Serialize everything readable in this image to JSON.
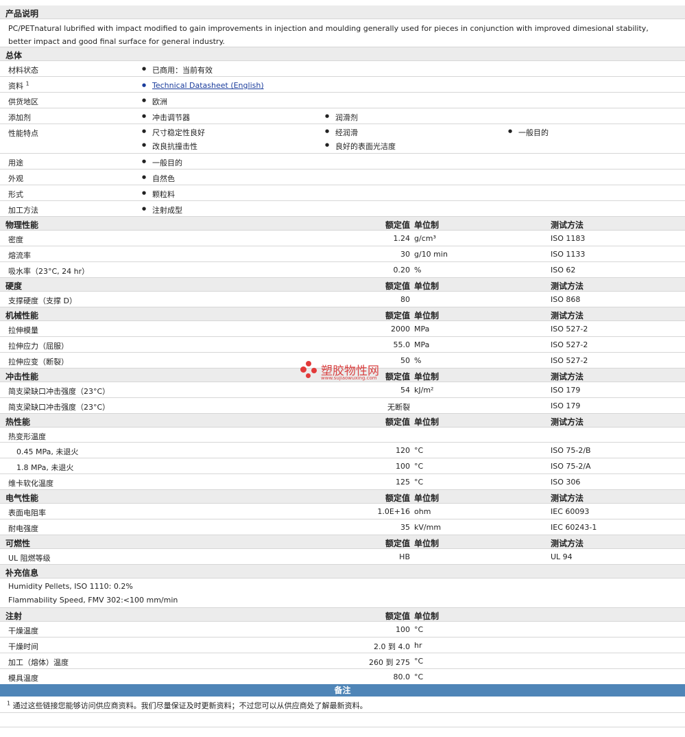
{
  "desc": {
    "header": "产品说明",
    "text": "PC/PETnatural lubrified with impact modified to gain improvements in injection and moulding generally used for pieces in conjunction with improved dimesional stability, better impact and good final surface for general industry."
  },
  "general": {
    "header": "总体",
    "status_label": "材料状态",
    "status_value": "已商用：当前有效",
    "resource_label": "资料",
    "resource_sup": "1",
    "resource_link": "Technical Datasheet (English)",
    "region_label": "供货地区",
    "region_value": "欧洲",
    "additive_label": "添加剂",
    "additive_1": "冲击调节器",
    "additive_2": "润滑剂",
    "feature_label": "性能特点",
    "feature_1": "尺寸稳定性良好",
    "feature_2": "经润滑",
    "feature_3": "一般目的",
    "feature_4": "改良抗撞击性",
    "feature_5": "良好的表面光洁度",
    "use_label": "用途",
    "use_value": "一般目的",
    "look_label": "外观",
    "look_value": "自然色",
    "form_label": "形式",
    "form_value": "颗粒料",
    "proc_label": "加工方法",
    "proc_value": "注射成型"
  },
  "col_value": "额定值",
  "col_unit": "单位制",
  "col_method": "测试方法",
  "physical": {
    "header": "物理性能",
    "rows": [
      {
        "label": "密度",
        "value": "1.24",
        "unit": "g/cm³",
        "method": "ISO 1183"
      },
      {
        "label": "熔流率",
        "value": "30",
        "unit": "g/10 min",
        "method": "ISO 1133"
      },
      {
        "label": "吸水率（23°C, 24 hr）",
        "value": "0.20",
        "unit": "%",
        "method": "ISO 62"
      }
    ]
  },
  "hardness": {
    "header": "硬度",
    "rows": [
      {
        "label": "支撑硬度（支撑 D）",
        "value": "80",
        "unit": "",
        "method": "ISO 868"
      }
    ]
  },
  "mechanical": {
    "header": "机械性能",
    "rows": [
      {
        "label": "拉伸模量",
        "value": "2000",
        "unit": "MPa",
        "method": "ISO 527-2"
      },
      {
        "label": "拉伸应力（屈服）",
        "value": "55.0",
        "unit": "MPa",
        "method": "ISO 527-2"
      },
      {
        "label": "拉伸应变（断裂）",
        "value": "50",
        "unit": "%",
        "method": "ISO 527-2"
      }
    ]
  },
  "impact": {
    "header": "冲击性能",
    "rows": [
      {
        "label": "简支梁缺口冲击强度（23°C）",
        "value": "54",
        "unit": "kJ/m²",
        "method": "ISO 179"
      },
      {
        "label": "简支梁缺口冲击强度（23°C）",
        "value": "无断裂",
        "unit": "",
        "method": "ISO 179"
      }
    ]
  },
  "thermal": {
    "header": "热性能",
    "hdt_label": "热变形温度",
    "rows": [
      {
        "label": "0.45 MPa, 未退火",
        "value": "120",
        "unit": "°C",
        "method": "ISO 75-2/B"
      },
      {
        "label": "1.8 MPa, 未退火",
        "value": "100",
        "unit": "°C",
        "method": "ISO 75-2/A"
      },
      {
        "label": "维卡软化温度",
        "value": "125",
        "unit": "°C",
        "method": "ISO 306"
      }
    ]
  },
  "electrical": {
    "header": "电气性能",
    "rows": [
      {
        "label": "表面电阻率",
        "value": "1.0E+16",
        "unit": "ohm",
        "method": "IEC 60093"
      },
      {
        "label": "耐电强度",
        "value": "35",
        "unit": "kV/mm",
        "method": "IEC 60243-1"
      }
    ]
  },
  "flammability": {
    "header": "可燃性",
    "rows": [
      {
        "label": "UL 阻燃等级",
        "value": "HB",
        "unit": "",
        "method": "UL 94"
      }
    ]
  },
  "supplement": {
    "header": "补充信息",
    "line1": "Humidity Pellets, ISO 1110: 0.2%",
    "line2": "Flammability Speed, FMV 302:<100 mm/min"
  },
  "injection": {
    "header": "注射",
    "rows": [
      {
        "label": "干燥温度",
        "value": "100",
        "unit": "°C"
      },
      {
        "label": "干燥时间",
        "value": "2.0 到  4.0",
        "unit": "hr"
      },
      {
        "label": "加工（熔体）温度",
        "value": "260 到  275",
        "unit": "°C"
      },
      {
        "label": "模具温度",
        "value": "80.0",
        "unit": "°C"
      }
    ]
  },
  "footnote": {
    "header": "备注",
    "sup": "1",
    "text": "通过这些链接您能够访问供应商资料。我们尽量保证及时更新资料；不过您可以从供应商处了解最新资料。"
  },
  "watermark": {
    "title": "塑胶物性网",
    "url": "www.sujiaowuxing.com"
  }
}
